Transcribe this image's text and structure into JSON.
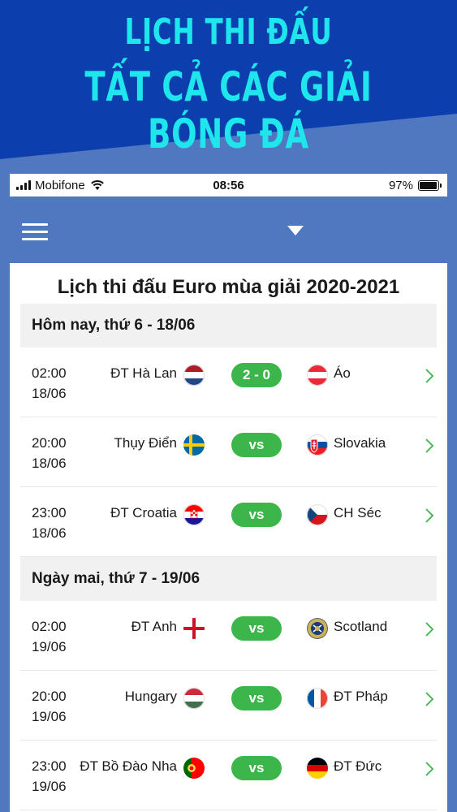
{
  "banner": {
    "line1": "LỊCH THI ĐẤU",
    "line2": "TẤT CẢ CÁC GIẢI BÓNG ĐÁ",
    "text_color": "#1ee6ec"
  },
  "status_bar": {
    "carrier": "Mobifone",
    "time": "08:56",
    "battery": "97%"
  },
  "app_bar": {
    "menu_icon": "hamburger-icon",
    "dropdown_icon": "caret-down-icon"
  },
  "page_title": "Lịch thi đấu Euro mùa giải 2020-2021",
  "days": [
    {
      "label": "Hôm nay, thứ 6 - 18/06",
      "matches": [
        {
          "time": "02:00",
          "date": "18/06",
          "home": "ĐT Hà Lan",
          "away": "Áo",
          "score": "2 - 0",
          "home_flag": "netherlands-flag-icon",
          "away_flag": "austria-flag-icon"
        },
        {
          "time": "20:00",
          "date": "18/06",
          "home": "Thụy Điển",
          "away": "Slovakia",
          "score": "vs",
          "home_flag": "sweden-flag-icon",
          "away_flag": "slovakia-flag-icon"
        },
        {
          "time": "23:00",
          "date": "18/06",
          "home": "ĐT Croatia",
          "away": "CH Séc",
          "score": "vs",
          "home_flag": "croatia-flag-icon",
          "away_flag": "czech-flag-icon"
        }
      ]
    },
    {
      "label": "Ngày mai, thứ 7 - 19/06",
      "matches": [
        {
          "time": "02:00",
          "date": "19/06",
          "home": "ĐT Anh",
          "away": "Scotland",
          "score": "vs",
          "home_flag": "england-flag-icon",
          "away_flag": "scotland-badge-icon"
        },
        {
          "time": "20:00",
          "date": "19/06",
          "home": "Hungary",
          "away": "ĐT Pháp",
          "score": "vs",
          "home_flag": "hungary-flag-icon",
          "away_flag": "france-flag-icon"
        },
        {
          "time": "23:00",
          "date": "19/06",
          "home": "ĐT Bồ Đào Nha",
          "away": "ĐT Đức",
          "score": "vs",
          "home_flag": "portugal-flag-icon",
          "away_flag": "germany-flag-icon"
        }
      ]
    }
  ],
  "colors": {
    "score_badge": "#3cb54a",
    "background": "#4f78c0",
    "banner_dark": "#0d3fb0",
    "chevron": "#3cb54a"
  }
}
